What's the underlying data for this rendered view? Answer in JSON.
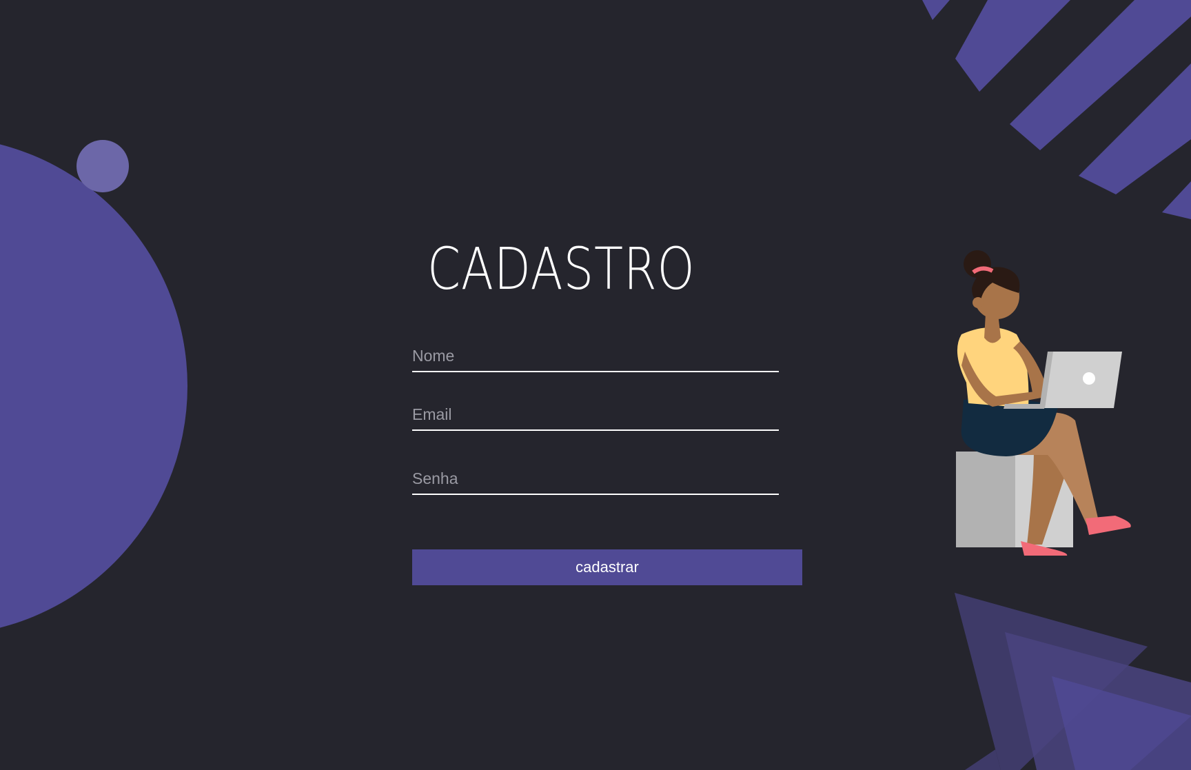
{
  "form": {
    "title": "CADASTRO",
    "fields": {
      "nome": {
        "placeholder": "Nome",
        "value": ""
      },
      "email": {
        "placeholder": "Email",
        "value": ""
      },
      "senha": {
        "placeholder": "Senha",
        "value": ""
      }
    },
    "submit_label": "cadastrar"
  },
  "colors": {
    "background": "#25252d",
    "accent": "#504a95",
    "accent_light": "#6c67a8",
    "text": "#ffffff",
    "placeholder": "#9a9aa3"
  },
  "illustration": {
    "subject": "woman-sitting-with-laptop-icon"
  }
}
